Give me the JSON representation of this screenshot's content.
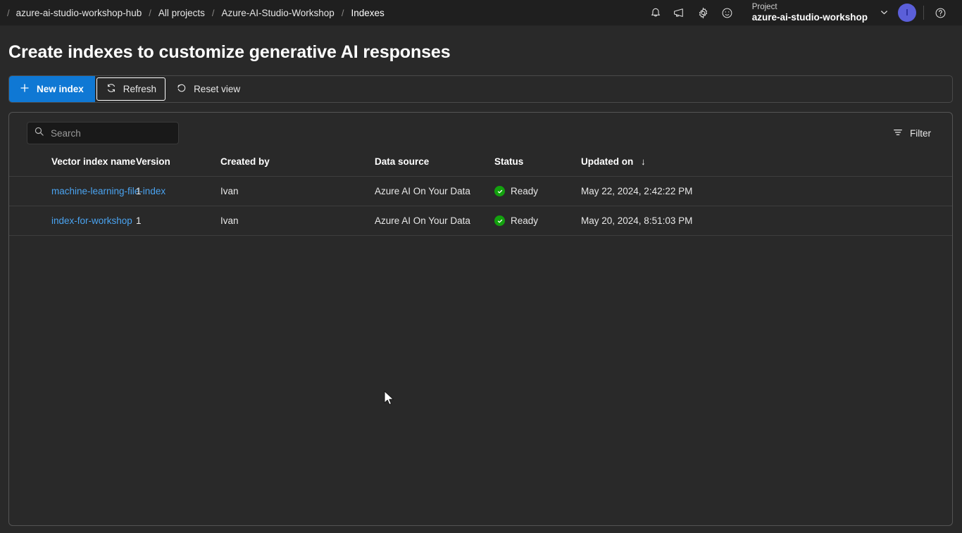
{
  "header": {
    "breadcrumb": [
      {
        "label": "azure-ai-studio-workshop-hub",
        "current": false
      },
      {
        "label": "All projects",
        "current": false
      },
      {
        "label": "Azure-AI-Studio-Workshop",
        "current": false
      },
      {
        "label": "Indexes",
        "current": true
      }
    ],
    "separator": "/",
    "icons": [
      {
        "name": "notifications-bell-icon",
        "title": "Notifications"
      },
      {
        "name": "feedback-megaphone-icon",
        "title": "Feedback"
      },
      {
        "name": "settings-gear-icon",
        "title": "Settings"
      },
      {
        "name": "smiley-feedback-icon",
        "title": "Send a smile"
      }
    ],
    "project": {
      "label": "Project",
      "name": "azure-ai-studio-workshop"
    },
    "avatar_initial": "I",
    "help_icon": "help-question-icon"
  },
  "page": {
    "title": "Create indexes to customize generative AI responses"
  },
  "toolbar": {
    "new_index_label": "New index",
    "refresh_label": "Refresh",
    "reset_view_label": "Reset view"
  },
  "search": {
    "placeholder": "Search",
    "value": ""
  },
  "filter": {
    "label": "Filter"
  },
  "table": {
    "columns": [
      "Vector index name",
      "Version",
      "Created by",
      "Data source",
      "Status",
      "Updated on"
    ],
    "sort_column": "Updated on",
    "sort_indicator": "↓",
    "rows": [
      {
        "name": "machine-learning-file-index",
        "version": "1",
        "created_by": "Ivan",
        "data_source": "Azure AI On Your Data",
        "status": "Ready",
        "updated_on": "May 22, 2024, 2:42:22 PM"
      },
      {
        "name": "index-for-workshop",
        "version": "1",
        "created_by": "Ivan",
        "data_source": "Azure AI On Your Data",
        "status": "Ready",
        "updated_on": "May 20, 2024, 8:51:03 PM"
      }
    ]
  },
  "colors": {
    "accent_blue": "#0f78d4",
    "link_blue": "#4aa3f0",
    "status_green": "#13a10e",
    "avatar_purple": "#5b5fd9",
    "page_background": "#292929",
    "header_background": "#1f1f1f"
  }
}
